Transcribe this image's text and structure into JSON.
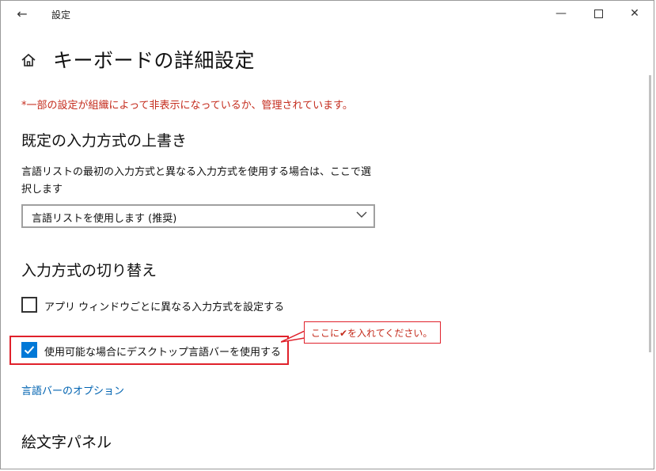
{
  "window": {
    "title": "設定",
    "back_glyph": "←",
    "minimize_glyph": "—",
    "close_glyph": "✕"
  },
  "page": {
    "title": "キーボードの詳細設定",
    "notice": "*一部の設定が組織によって非表示になっているか、管理されています。"
  },
  "override_section": {
    "heading": "既定の入力方式の上書き",
    "description": "言語リストの最初の入力方式と異なる入力方式を使用する場合は、ここで選択します",
    "dropdown_value": "言語リストを使用します (推奨)"
  },
  "switch_section": {
    "heading": "入力方式の切り替え",
    "checkbox_per_app": {
      "label": "アプリ ウィンドウごとに異なる入力方式を設定する",
      "checked": false
    },
    "checkbox_langbar": {
      "label": "使用可能な場合にデスクトップ言語バーを使用する",
      "checked": true
    },
    "link_langbar_options": "言語バーのオプション"
  },
  "emoji_section": {
    "heading": "絵文字パネル"
  },
  "annotation": {
    "callout_text": "ここに✔を入れてください。",
    "color": "#e0212b"
  },
  "colors": {
    "accent": "#0078d7",
    "link": "#0063b1",
    "notice": "#c42b1c"
  }
}
